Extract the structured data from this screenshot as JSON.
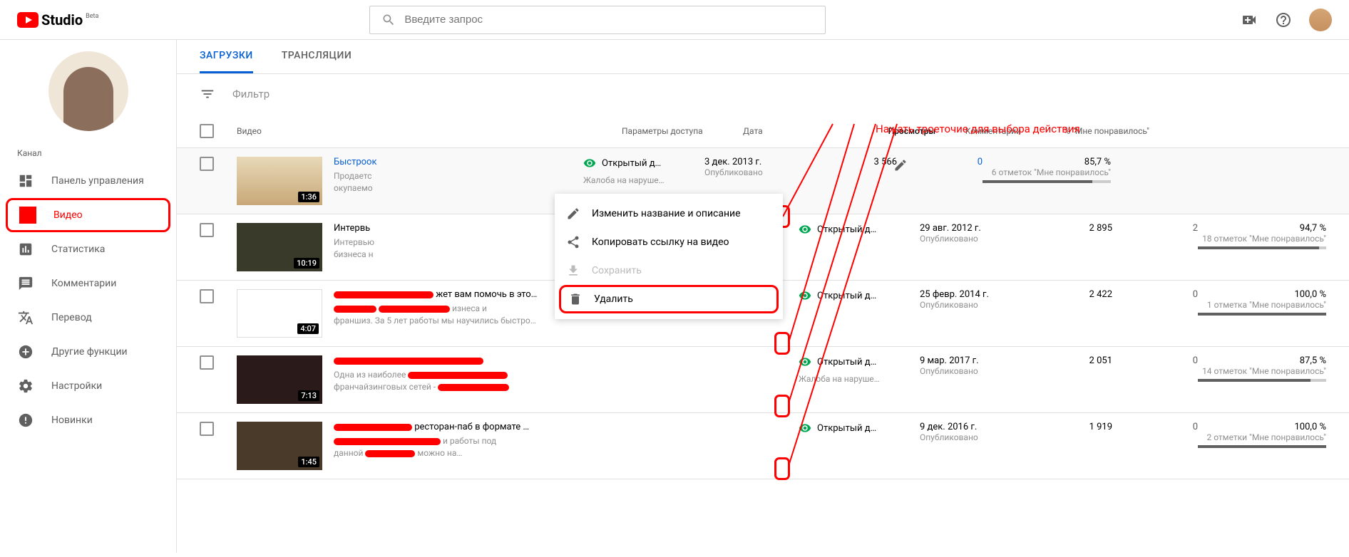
{
  "header": {
    "logo_text": "Studio",
    "logo_beta": "Beta",
    "search_placeholder": "Введите запрос"
  },
  "sidebar": {
    "channel_label": "Канал",
    "items": [
      {
        "label": "Панель управления"
      },
      {
        "label": "Видео"
      },
      {
        "label": "Статистика"
      },
      {
        "label": "Комментарии"
      },
      {
        "label": "Перевод"
      },
      {
        "label": "Другие функции"
      },
      {
        "label": "Настройки"
      },
      {
        "label": "Новинки"
      }
    ]
  },
  "tabs": {
    "uploads": "ЗАГРУЗКИ",
    "live": "ТРАНСЛЯЦИИ"
  },
  "filter_label": "Фильтр",
  "columns": {
    "video": "Видео",
    "access": "Параметры доступа",
    "date": "Дата",
    "views": "Просмотры",
    "comments": "Комментарии",
    "likes": "% \"Мне понравилось\""
  },
  "access_label": "Открытый д…",
  "published_label": "Опубликовано",
  "complaint_label": "Жалоба на наруше…",
  "rows": [
    {
      "duration": "1:36",
      "title": "Быстроок",
      "desc1": "Продаетс",
      "desc2": "окупаемо",
      "date": "3 дек. 2013 г.",
      "views": "3 566",
      "comments": "0",
      "likes_pct": "85,7 %",
      "likes_sub": "6 отметок \"Мне понравилось\"",
      "complaint": true,
      "blue_comment": true
    },
    {
      "duration": "10:19",
      "title": "Интервь",
      "desc1": "Интервью",
      "desc2": "бизнеса н",
      "date": "29 авг. 2012 г.",
      "views": "2 895",
      "comments": "2",
      "likes_pct": "94,7 %",
      "likes_sub": "18 отметок \"Мне понравилось\"",
      "complaint": false
    },
    {
      "duration": "4:07",
      "title_suffix": "жет вам помочь в это…",
      "desc1_suffix": "изнеса и",
      "desc2": "франшиз. За 5 лет работы мы научились быстро…",
      "date": "25 февр. 2014 г.",
      "views": "2 422",
      "comments": "0",
      "likes_pct": "100,0 %",
      "likes_sub": "1 отметка \"Мне понравилось\"",
      "complaint": false
    },
    {
      "duration": "7:13",
      "desc1": "Одна из наиболее",
      "desc2": "франчайзинговых сетей -",
      "date": "9 мар. 2017 г.",
      "views": "2 051",
      "comments": "0",
      "likes_pct": "87,5 %",
      "likes_sub": "14 отметок \"Мне понравилось\"",
      "complaint": true
    },
    {
      "duration": "1:45",
      "title_suffix": " ресторан-паб в формате …",
      "desc1_suffix": "и работы под",
      "desc2_prefix": "данной",
      "desc2_suffix": "можно на…",
      "date": "9 дек. 2016 г.",
      "views": "1 919",
      "comments": "0",
      "likes_pct": "100,0 %",
      "likes_sub": "2 отметки \"Мне понравилось\"",
      "complaint": false
    }
  ],
  "menu": {
    "edit": "Изменить название и описание",
    "copy": "Копировать ссылку на видео",
    "save": "Сохранить",
    "delete": "Удалить"
  },
  "annotation": "Нажать троеточие для выбора действия"
}
